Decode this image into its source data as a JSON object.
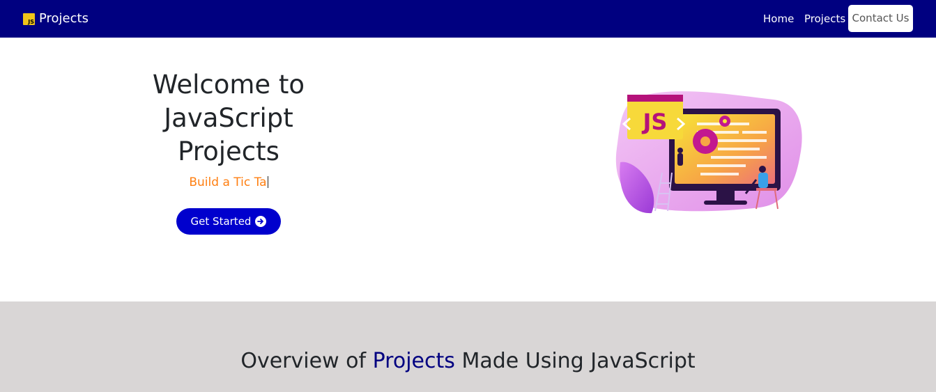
{
  "navbar": {
    "logo_text": "JS",
    "brand": "Projects",
    "links": [
      "Home",
      "Projects"
    ],
    "contact": "Contact Us",
    "bg_color": "#000080"
  },
  "hero": {
    "title_lines": [
      "Welcome to",
      "JavaScript",
      "Projects"
    ],
    "typing_text": "Build a Tic Ta",
    "typing_color": "#ff7f11",
    "cta_label": "Get Started",
    "cta_icon": "arrow-circle-right-icon",
    "cta_color": "#0000cd",
    "illustration_badge": "JS"
  },
  "overview": {
    "title_pre": "Overview of",
    "title_highlight": "Projects",
    "title_post": "Made Using JavaScript",
    "bg_color": "#d9d6d6",
    "highlight_color": "#000080"
  }
}
